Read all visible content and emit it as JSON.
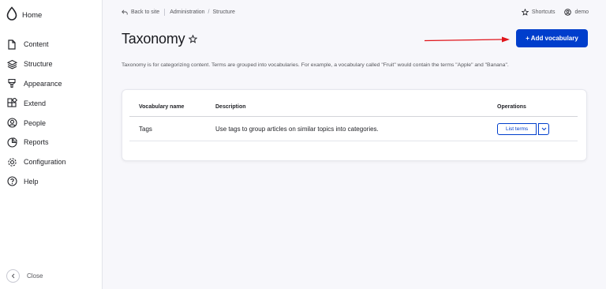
{
  "sidebar": {
    "home_label": "Home",
    "items": [
      {
        "label": "Content",
        "icon": "file-icon"
      },
      {
        "label": "Structure",
        "icon": "layers-icon"
      },
      {
        "label": "Appearance",
        "icon": "brush-icon"
      },
      {
        "label": "Extend",
        "icon": "puzzle-icon"
      },
      {
        "label": "People",
        "icon": "user-circle-icon"
      },
      {
        "label": "Reports",
        "icon": "pie-chart-icon"
      },
      {
        "label": "Configuration",
        "icon": "gear-icon"
      },
      {
        "label": "Help",
        "icon": "help-circle-icon"
      }
    ],
    "close_label": "Close"
  },
  "topbar": {
    "back_label": "Back to site",
    "breadcrumb": [
      "Administration",
      "Structure"
    ],
    "shortcuts_label": "Shortcuts",
    "user_label": "demo"
  },
  "page": {
    "title": "Taxonomy",
    "add_button_label": "+ Add vocabulary",
    "description": "Taxonomy is for categorizing content. Terms are grouped into vocabularies. For example, a vocabulary called \"Fruit\" would contain the terms \"Apple\" and \"Banana\"."
  },
  "table": {
    "headers": {
      "name": "Vocabulary name",
      "description": "Description",
      "operations": "Operations"
    },
    "rows": [
      {
        "name": "Tags",
        "description": "Use tags to group articles on similar topics into categories.",
        "operation": "List terms"
      }
    ]
  },
  "colors": {
    "accent": "#003ecc",
    "annotation_arrow": "#e0151b"
  }
}
